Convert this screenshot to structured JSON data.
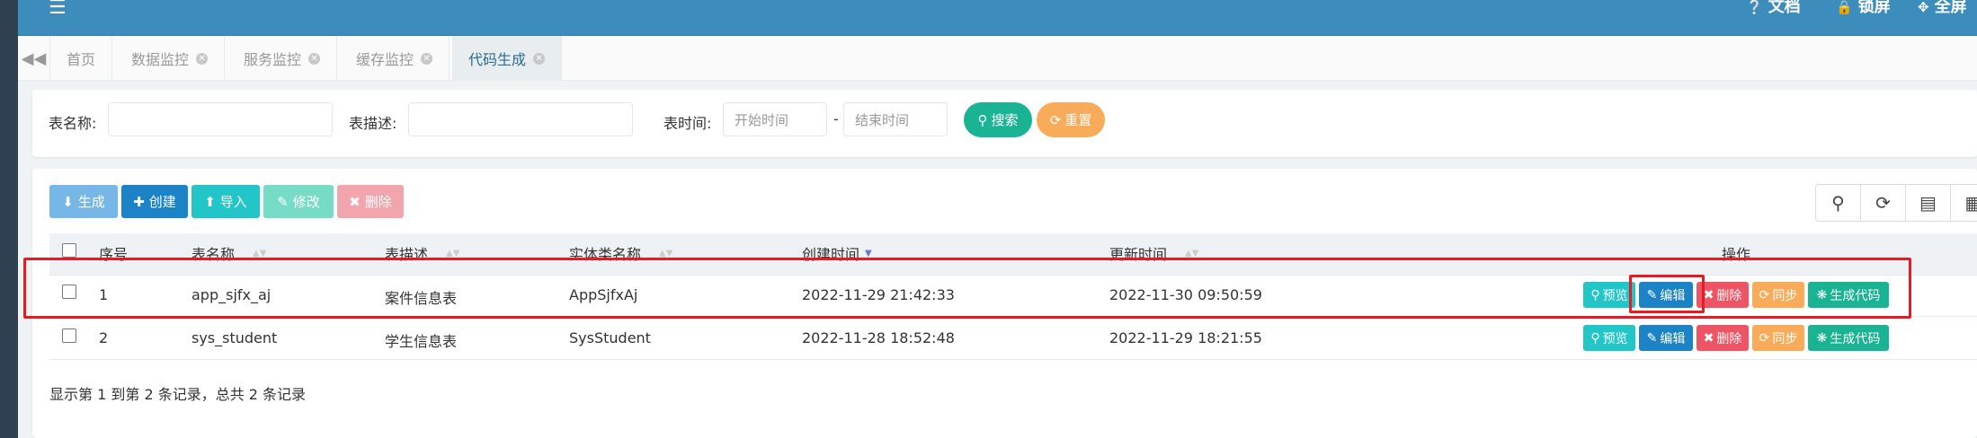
{
  "colors": {
    "topbar": "#3c8dbc",
    "success": "#1ab394",
    "warning": "#f8ac59",
    "primary": "#1c84c6",
    "info": "#23c6c8",
    "danger": "#ed5565",
    "annotation": "#e51c23"
  },
  "topbar": {
    "menu_icon": "bars-icon",
    "links": [
      {
        "icon": "question-circle-icon",
        "label": "文档"
      },
      {
        "icon": "lock-icon",
        "label": "锁屏"
      },
      {
        "icon": "expand-icon",
        "label": "全屏"
      }
    ]
  },
  "tabs": [
    {
      "label": "首页",
      "closable": false
    },
    {
      "label": "数据监控",
      "closable": true
    },
    {
      "label": "服务监控",
      "closable": true
    },
    {
      "label": "缓存监控",
      "closable": true
    },
    {
      "label": "代码生成",
      "closable": true,
      "active": true
    }
  ],
  "search": {
    "table_name_label": "表名称:",
    "table_name_value": "",
    "table_desc_label": "表描述:",
    "table_desc_value": "",
    "table_time_label": "表时间:",
    "start_placeholder": "开始时间",
    "separator": "-",
    "end_placeholder": "结束时间",
    "search_label": "搜索",
    "reset_label": "重置"
  },
  "toolbar": {
    "generate_label": "生成",
    "create_label": "创建",
    "import_label": "导入",
    "edit_label": "修改",
    "delete_label": "删除"
  },
  "table": {
    "columns": [
      "序号",
      "表名称",
      "表描述",
      "实体类名称",
      "创建时间",
      "更新时间",
      "操作"
    ],
    "rows": [
      {
        "index": "1",
        "table_name": "app_sjfx_aj",
        "table_desc": "案件信息表",
        "entity": "AppSjfxAj",
        "created": "2022-11-29 21:42:33",
        "updated": "2022-11-30 09:50:59"
      },
      {
        "index": "2",
        "table_name": "sys_student",
        "table_desc": "学生信息表",
        "entity": "SysStudent",
        "created": "2022-11-28 18:52:48",
        "updated": "2022-11-29 18:21:55"
      }
    ],
    "row_actions": {
      "preview": "预览",
      "edit": "编辑",
      "delete": "删除",
      "sync": "同步",
      "generate": "生成代码"
    },
    "footer": "显示第 1 到第 2 条记录，总共 2 条记录"
  }
}
